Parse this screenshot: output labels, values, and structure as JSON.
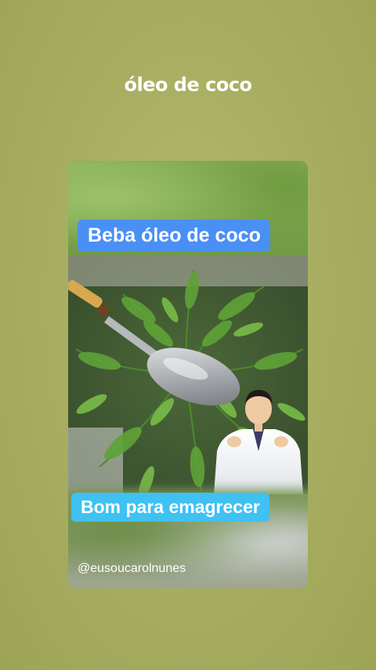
{
  "story": {
    "title": "óleo de coco",
    "background_color": "#a9af62"
  },
  "video": {
    "caption_top": "Beba óleo de coco",
    "caption_top_color": "#4a90f4",
    "caption_bottom": "Bom para emagrecer",
    "caption_bottom_color": "#3fc1f2",
    "handle": "@eusoucarolnunes",
    "scene": {
      "icons": [
        "fern-plant-icon",
        "spoon-icon",
        "doctor-avatar-icon"
      ]
    }
  }
}
